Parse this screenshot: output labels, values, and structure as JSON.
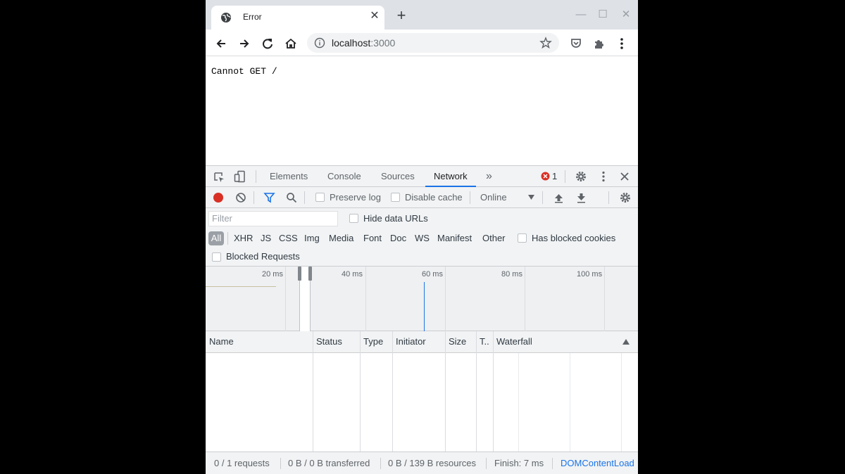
{
  "tab": {
    "title": "Error",
    "close_label": "✕"
  },
  "window_controls": {
    "minimize": "—",
    "maximize": "☐",
    "close": "✕"
  },
  "omnibox": {
    "host": "localhost",
    "port": ":3000"
  },
  "page": {
    "text": "Cannot GET /"
  },
  "devtools": {
    "tabs": [
      "Elements",
      "Console",
      "Sources",
      "Network"
    ],
    "active_tab": "Network",
    "more_tabs": "»",
    "error_count": "1"
  },
  "network_toolbar": {
    "preserve_log": "Preserve log",
    "disable_cache": "Disable cache",
    "throttling": "Online"
  },
  "filter": {
    "placeholder": "Filter",
    "hide_data_urls": "Hide data URLs",
    "types": [
      "All",
      "XHR",
      "JS",
      "CSS",
      "Img",
      "Media",
      "Font",
      "Doc",
      "WS",
      "Manifest",
      "Other"
    ],
    "has_blocked_cookies": "Has blocked cookies",
    "blocked_requests": "Blocked Requests"
  },
  "overview": {
    "ticks": [
      "20 ms",
      "40 ms",
      "60 ms",
      "80 ms",
      "100 ms"
    ]
  },
  "table": {
    "columns": [
      "Name",
      "Status",
      "Type",
      "Initiator",
      "Size",
      "T..",
      "Waterfall"
    ]
  },
  "status": {
    "requests": "0 / 1 requests",
    "transferred": "0 B / 0 B transferred",
    "resources": "0 B / 139 B resources",
    "finish": "Finish: 7 ms",
    "dom_content": "DOMContentLoad"
  },
  "colors": {
    "accent": "#1a73e8",
    "record": "#d93025",
    "error": "#d93025"
  }
}
